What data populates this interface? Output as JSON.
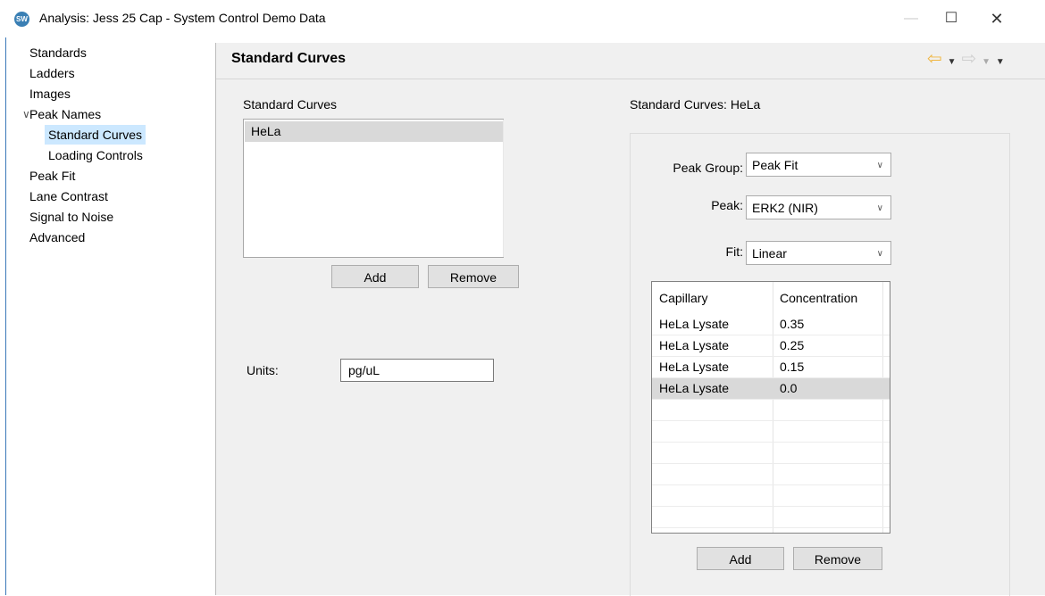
{
  "window": {
    "app_icon_text": "SW",
    "title": "Analysis: Jess 25 Cap - System Control Demo Data",
    "minimize": "—",
    "maximize": "☐",
    "close": "✕"
  },
  "sidebar": {
    "items": [
      {
        "label": "Standards"
      },
      {
        "label": "Ladders"
      },
      {
        "label": "Images"
      },
      {
        "label": "Peak Names",
        "expanded": true
      },
      {
        "label": "Standard Curves",
        "selected": true
      },
      {
        "label": "Loading Controls"
      },
      {
        "label": "Peak Fit"
      },
      {
        "label": "Lane Contrast"
      },
      {
        "label": "Signal to Noise"
      },
      {
        "label": "Advanced"
      }
    ]
  },
  "header": {
    "title": "Standard Curves"
  },
  "left_panel": {
    "list_label": "Standard Curves",
    "list_items": [
      {
        "label": "HeLa",
        "selected": true
      }
    ],
    "add_label": "Add",
    "remove_label": "Remove",
    "units_label": "Units:",
    "units_value": "pg/uL"
  },
  "right_panel": {
    "title": "Standard Curves: HeLa",
    "peak_group_label": "Peak Group:",
    "peak_group_value": "Peak Fit",
    "peak_label": "Peak:",
    "peak_value": "ERK2 (NIR)",
    "fit_label": "Fit:",
    "fit_value": "Linear",
    "table": {
      "columns": [
        "Capillary",
        "Concentration"
      ],
      "rows": [
        {
          "capillary": "HeLa Lysate",
          "concentration": "0.35"
        },
        {
          "capillary": "HeLa Lysate",
          "concentration": "0.25"
        },
        {
          "capillary": "HeLa Lysate",
          "concentration": "0.15"
        },
        {
          "capillary": "HeLa Lysate",
          "concentration": "0.0",
          "selected": true
        }
      ]
    },
    "add_label": "Add",
    "remove_label": "Remove"
  },
  "colors": {
    "selection": "#cce8ff",
    "row_selected": "#d9d9d9",
    "back_arrow": "#f0b640",
    "panel_bg": "#f0f0f0"
  },
  "icons": {
    "back": "arrow-left-icon",
    "forward": "arrow-right-icon",
    "dropdown": "chevron-down-icon"
  }
}
